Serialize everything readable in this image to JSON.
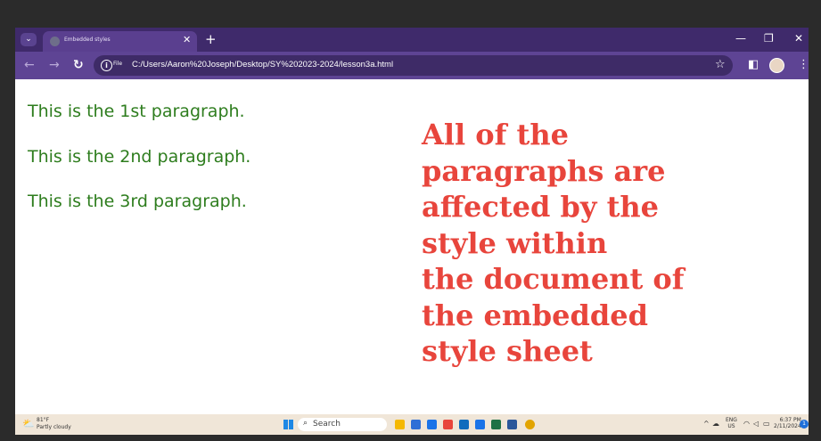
{
  "browser": {
    "tab_title": "Embedded styles",
    "url": "C:/Users/Aaron%20Joseph/Desktop/SY%202023-2024/lesson3a.html",
    "site_chip": "File",
    "accent": "#3f2a6b"
  },
  "page": {
    "paragraphs": [
      "This is the 1st paragraph.",
      "This is the 2nd paragraph.",
      "This is the 3rd paragraph."
    ],
    "note_lines": [
      "All of the",
      "paragraphs are",
      "affected by the",
      "style within",
      "the document of",
      "the embedded",
      "style sheet"
    ],
    "paragraph_color": "#2e7d1e",
    "note_color": "#e8453c"
  },
  "taskbar": {
    "temperature": "81°F",
    "condition": "Partly cloudy",
    "search_placeholder": "Search",
    "lang_top": "ENG",
    "lang_bottom": "US",
    "time": "6:37 PM",
    "date": "2/11/2024",
    "notification_count": "1"
  }
}
